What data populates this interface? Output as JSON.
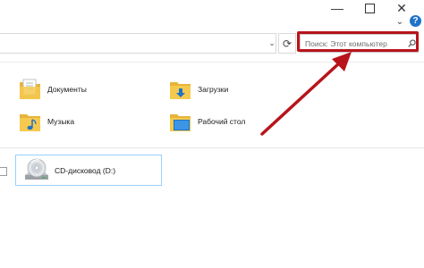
{
  "window": {
    "minimize_glyph": "—",
    "close_glyph": "✕",
    "ribbon_toggle_glyph": "⌄",
    "help_glyph": "?"
  },
  "address_bar": {
    "history_glyph": "⌄",
    "refresh_glyph": "⟳"
  },
  "search": {
    "placeholder": "Поиск: Этот компьютер"
  },
  "folders": [
    {
      "label": "Документы",
      "icon": "documents-folder-icon"
    },
    {
      "label": "Загрузки",
      "icon": "downloads-folder-icon"
    },
    {
      "label": "Музыка",
      "icon": "music-folder-icon"
    },
    {
      "label": "Рабочий стол",
      "icon": "desktop-folder-icon"
    }
  ],
  "drives": [
    {
      "label": "CD-дисковод (D:)",
      "icon": "cd-drive-icon"
    }
  ],
  "colors": {
    "highlight": "#b8141b",
    "arrow": "#b8141b",
    "folder": "#f5c94e",
    "selection_border": "#99cfff",
    "accent_blue": "#1e73c8"
  }
}
